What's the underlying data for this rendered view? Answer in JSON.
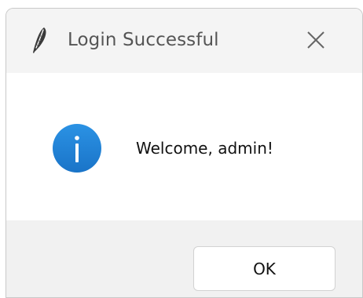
{
  "dialog": {
    "title": "Login Successful",
    "app_icon": "feather-icon",
    "close_icon": "close-icon",
    "message_icon": "info-icon",
    "message": "Welcome, admin!",
    "ok_label": "OK"
  },
  "colors": {
    "titlebar_bg": "#f4f4f4",
    "content_bg": "#ffffff",
    "footer_bg": "#f1f1f1",
    "info_blue": "#1e7fd1",
    "title_text": "#555555"
  }
}
